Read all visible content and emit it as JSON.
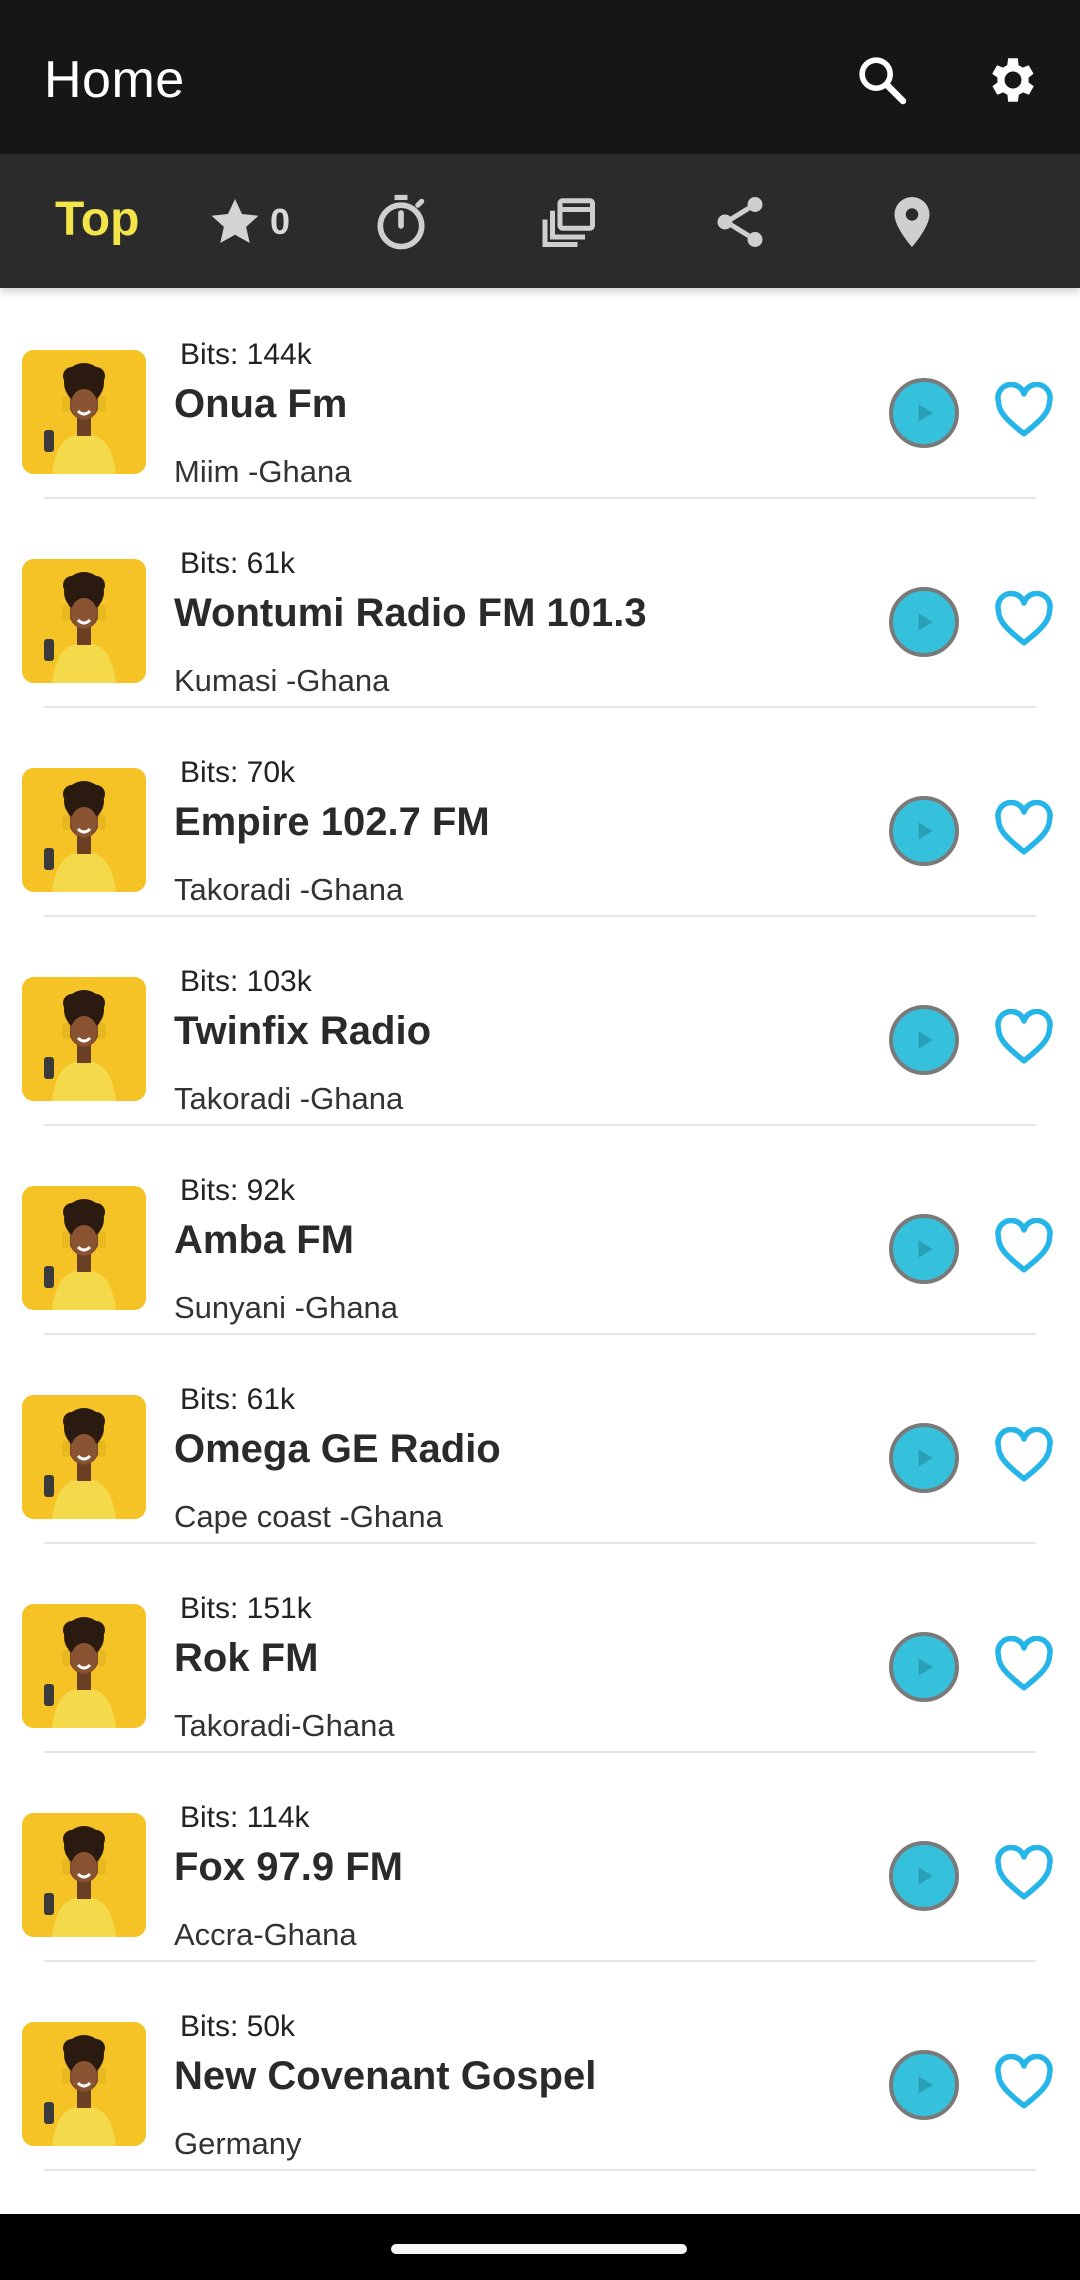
{
  "appbar": {
    "title": "Home",
    "search_icon": "search-icon",
    "settings_icon": "gear-icon"
  },
  "toolbar": {
    "top_label": "Top",
    "favorites_count": "0",
    "icons": [
      "star-icon",
      "timer-icon",
      "windows-icon",
      "share-icon",
      "location-icon"
    ]
  },
  "colors": {
    "appbar_bg": "#161616",
    "toolbar_bg": "#2b2b2b",
    "top_tab": "#f3e44a",
    "play": "#35c0dc",
    "heart": "#26b5e8"
  },
  "stations": [
    {
      "bits": "Bits: 144k",
      "name": "Onua Fm",
      "location": "Miim -Ghana"
    },
    {
      "bits": "Bits: 61k",
      "name": "Wontumi Radio FM 101.3",
      "location": "Kumasi -Ghana"
    },
    {
      "bits": "Bits: 70k",
      "name": "Empire 102.7 FM",
      "location": "Takoradi -Ghana"
    },
    {
      "bits": "Bits: 103k",
      "name": "Twinfix Radio",
      "location": "Takoradi -Ghana"
    },
    {
      "bits": "Bits: 92k",
      "name": "Amba FM",
      "location": "Sunyani -Ghana"
    },
    {
      "bits": "Bits: 61k",
      "name": "Omega GE Radio",
      "location": "Cape coast -Ghana"
    },
    {
      "bits": "Bits: 151k",
      "name": "Rok FM",
      "location": "Takoradi-Ghana"
    },
    {
      "bits": "Bits: 114k",
      "name": "Fox 97.9 FM",
      "location": "Accra-Ghana"
    },
    {
      "bits": "Bits: 50k",
      "name": "New Covenant Gospel",
      "location": "Germany"
    }
  ]
}
